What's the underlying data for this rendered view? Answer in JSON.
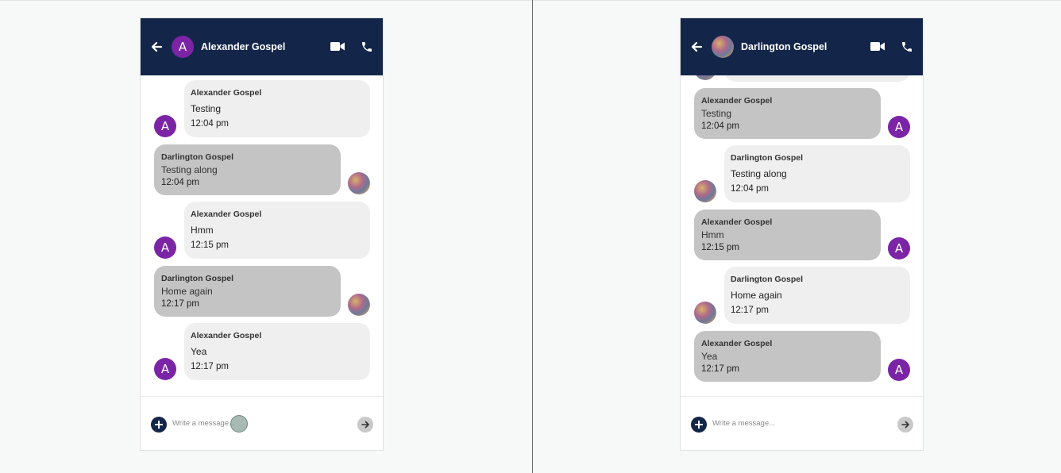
{
  "left_chat": {
    "header": {
      "name": "Alexander Gospel",
      "avatar_letter": "A"
    },
    "messages": [
      {
        "sender": "Alexander Gospel",
        "text": "Testing",
        "time": "12:04 pm",
        "avatar_letter": "A"
      },
      {
        "sender": "Darlington Gospel",
        "text": "Testing along",
        "time": "12:04 pm"
      },
      {
        "sender": "Alexander Gospel",
        "text": "Hmm",
        "time": "12:15 pm",
        "avatar_letter": "A"
      },
      {
        "sender": "Darlington Gospel",
        "text": "Home again",
        "time": "12:17 pm"
      },
      {
        "sender": "Alexander Gospel",
        "text": "Yea",
        "time": "12:17 pm",
        "avatar_letter": "A"
      }
    ],
    "composer": {
      "placeholder": "Write a message..."
    }
  },
  "right_chat": {
    "header": {
      "name": "Darlington Gospel"
    },
    "messages": [
      {
        "sender": "Alexander Gospel",
        "text": "Testing",
        "time": "12:04 pm",
        "avatar_letter": "A"
      },
      {
        "sender": "Darlington Gospel",
        "text": "Testing along",
        "time": "12:04 pm"
      },
      {
        "sender": "Alexander Gospel",
        "text": "Hmm",
        "time": "12:15 pm",
        "avatar_letter": "A"
      },
      {
        "sender": "Darlington Gospel",
        "text": "Home again",
        "time": "12:17 pm"
      },
      {
        "sender": "Alexander Gospel",
        "text": "Yea",
        "time": "12:17 pm",
        "avatar_letter": "A"
      }
    ],
    "composer": {
      "placeholder": "Write a message..."
    }
  },
  "icons": {
    "back": "arrow-left-icon",
    "video": "video-camera-icon",
    "phone": "phone-icon",
    "add": "plus-icon",
    "send": "arrow-right-icon"
  },
  "colors": {
    "header_bg": "#13264a",
    "avatar_purple": "#7b25a6",
    "own_bubble": "#efefef",
    "other_bubble": "#c4c4c4"
  }
}
